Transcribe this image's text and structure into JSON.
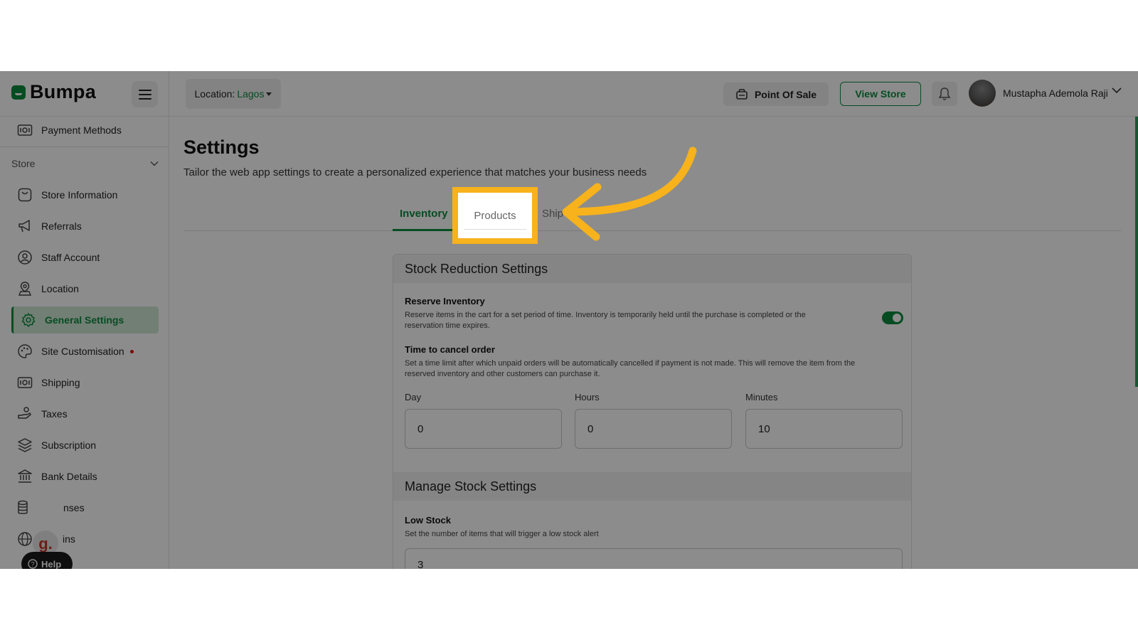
{
  "brand": {
    "name": "Bumpa"
  },
  "header": {
    "location_label": "Location:",
    "location_value": "Lagos",
    "pos_label": "Point Of Sale",
    "view_store_label": "View Store",
    "user_name": "Mustapha Ademola Raji"
  },
  "sidebar": {
    "top_item": "Payment Methods",
    "section": "Store",
    "items": [
      {
        "label": "Store Information",
        "icon": "bag-icon"
      },
      {
        "label": "Referrals",
        "icon": "megaphone-icon"
      },
      {
        "label": "Staff Account",
        "icon": "user-circle-icon"
      },
      {
        "label": "Location",
        "icon": "map-pin-icon"
      },
      {
        "label": "General Settings",
        "icon": "gear-icon",
        "active": true
      },
      {
        "label": "Site Customisation",
        "icon": "palette-icon"
      },
      {
        "label": "Shipping",
        "icon": "cash-icon"
      },
      {
        "label": "Taxes",
        "icon": "hand-coins-icon"
      },
      {
        "label": "Subscription",
        "icon": "layers-icon"
      },
      {
        "label": "Bank Details",
        "icon": "bank-icon"
      },
      {
        "label": "nses",
        "icon": "database-icon"
      },
      {
        "label": "ins",
        "icon": "globe-icon"
      }
    ],
    "help_label": "Help",
    "widget_letter": "g."
  },
  "main": {
    "title": "Settings",
    "subtitle": "Tailor the web app settings to create a personalized experience that matches your business needs",
    "tabs": [
      {
        "label": "Inventory",
        "active": true
      },
      {
        "label": "Products",
        "highlighted": true
      },
      {
        "label": "Ship"
      }
    ],
    "stock_reduction": {
      "heading": "Stock Reduction Settings",
      "reserve_title": "Reserve Inventory",
      "reserve_desc_1": "Reserve items in the cart for a set period of time. Inventory is temporarily held until the purchase is completed or the",
      "reserve_desc_2": "reservation time expires.",
      "reserve_enabled": true,
      "cancel_title": "Time to cancel order",
      "cancel_desc_1": "Set a time limit after which unpaid orders will be automatically cancelled if payment is not made. This will remove the item from the",
      "cancel_desc_2": "reserved inventory and other customers can purchase it.",
      "day_label": "Day",
      "day_value": "0",
      "hours_label": "Hours",
      "hours_value": "0",
      "minutes_label": "Minutes",
      "minutes_value": "10"
    },
    "manage_stock": {
      "heading": "Manage Stock Settings",
      "low_title": "Low Stock",
      "low_desc": "Set the number of items that will trigger a low stock alert",
      "low_value": "3"
    }
  },
  "colors": {
    "brand_green": "#0b8a3f",
    "highlight": "#f7b21c"
  }
}
